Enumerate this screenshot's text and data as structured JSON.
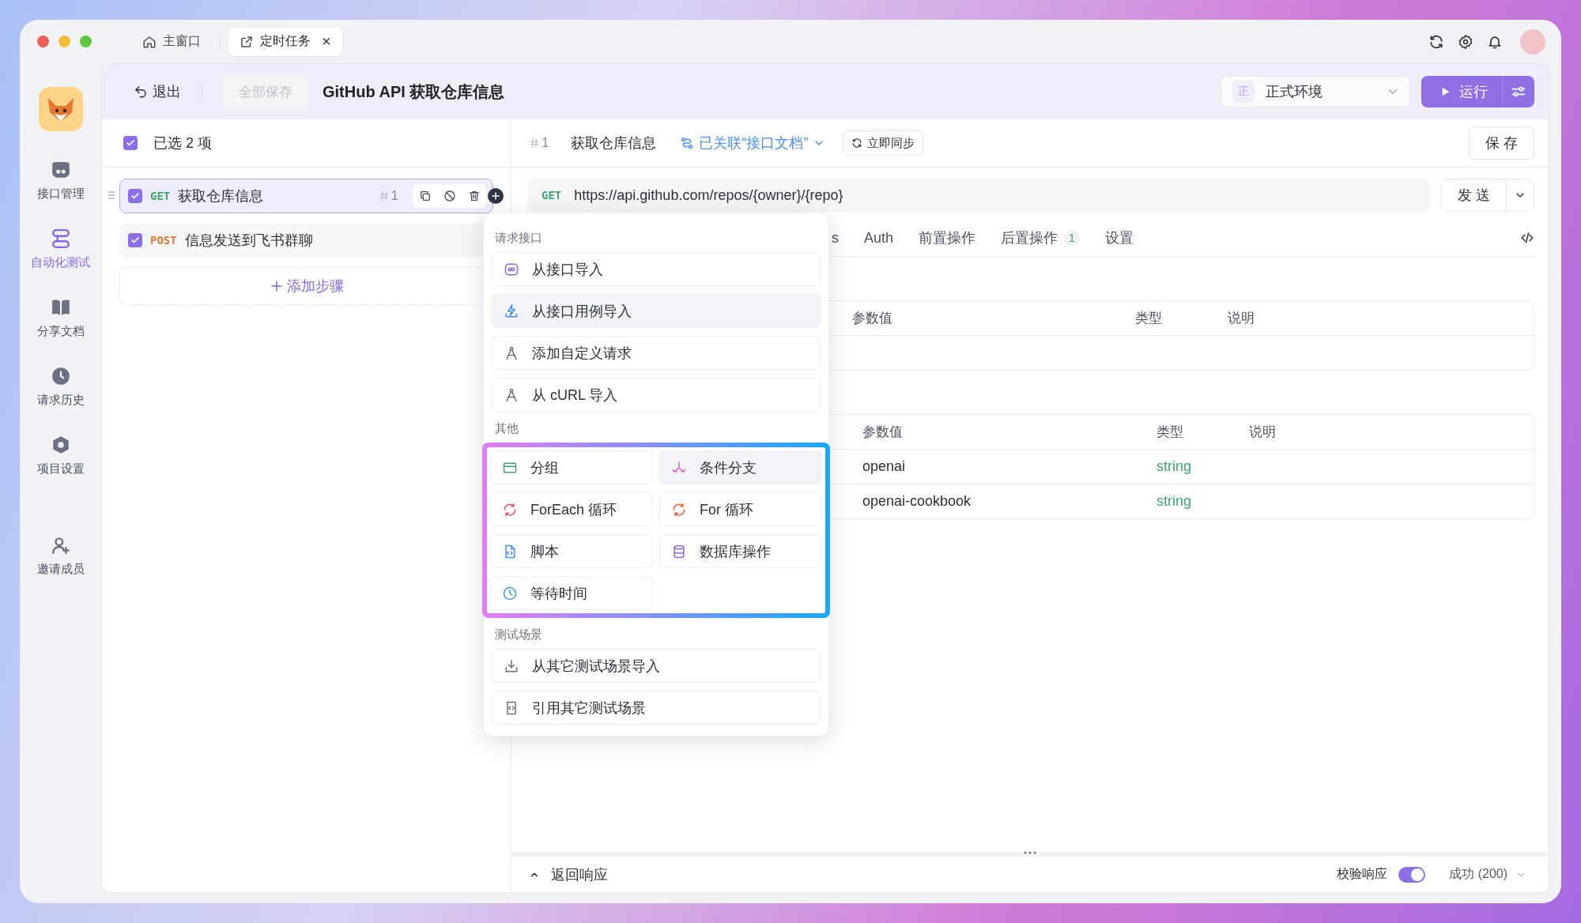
{
  "window_tabs": [
    {
      "label": "主窗口",
      "selected": false
    },
    {
      "label": "定时任务",
      "selected": true,
      "close": "×"
    }
  ],
  "sidebar": {
    "items": [
      {
        "label": "接口管理",
        "selected": false
      },
      {
        "label": "自动化测试",
        "selected": true
      },
      {
        "label": "分享文档",
        "selected": false
      },
      {
        "label": "请求历史",
        "selected": false
      },
      {
        "label": "项目设置",
        "selected": false
      },
      {
        "label": "邀请成员",
        "selected": false
      }
    ]
  },
  "header": {
    "back": "退出",
    "save_all": {
      "label": "全部保存",
      "disabled": true
    },
    "title": "GitHub API 获取仓库信息",
    "environment": {
      "badge": "正",
      "label": "正式环境"
    },
    "run": "运行"
  },
  "steps_panel": {
    "selection": {
      "label": "已选 2 项",
      "checked": true
    },
    "steps": [
      {
        "method": "GET",
        "color": "#3fa56b",
        "name": "获取仓库信息",
        "number": "1",
        "checked": true,
        "selected": true
      },
      {
        "method": "POST",
        "color": "#e0782e",
        "name": "信息发送到飞书群聊",
        "checked": true,
        "selected": false
      }
    ],
    "add_step": "添加步骤"
  },
  "request": {
    "number": "1",
    "name": "获取仓库信息",
    "linked": "已关联“接口文档”",
    "sync": "立即同步",
    "save": "保 存",
    "method": "GET",
    "url": "https://api.github.com/repos/{owner}/{repo}",
    "send": "发 送",
    "tabs": [
      {
        "label": "s"
      },
      {
        "label": "Auth"
      },
      {
        "label": "前置操作"
      },
      {
        "label": "后置操作",
        "badge": "1"
      },
      {
        "label": "设置"
      }
    ],
    "tables": [
      {
        "columns": [
          "参数值",
          "类型",
          "说明"
        ]
      },
      {
        "columns": [
          "参数值",
          "类型",
          "说明"
        ],
        "rows": [
          {
            "value": "openai",
            "type": "string"
          },
          {
            "value": "openai-cookbook",
            "type": "string"
          }
        ]
      }
    ]
  },
  "response": {
    "label": "返回响应",
    "validate": {
      "label": "校验响应",
      "on": true
    },
    "status": "成功 (200)"
  },
  "menu": {
    "sections": [
      {
        "title": "请求接口",
        "kind": "list",
        "highlighted": false,
        "items": [
          {
            "label": "从接口导入",
            "hovered": false
          },
          {
            "label": "从接口用例导入",
            "hovered": true
          },
          {
            "label": "添加自定义请求",
            "hovered": false
          },
          {
            "label": "从 cURL 导入",
            "hovered": false
          }
        ]
      },
      {
        "title": "其他",
        "kind": "grid",
        "highlighted": true,
        "items": [
          {
            "label": "分组",
            "hovered": false
          },
          {
            "label": "条件分支",
            "hovered": true
          },
          {
            "label": "ForEach 循环",
            "hovered": false
          },
          {
            "label": "For 循环",
            "hovered": false
          },
          {
            "label": "脚本",
            "hovered": false
          },
          {
            "label": "数据库操作",
            "hovered": false
          },
          {
            "label": "等待时间",
            "hovered": false
          }
        ]
      },
      {
        "title": "测试场景",
        "kind": "list",
        "highlighted": false,
        "items": [
          {
            "label": "从其它测试场景导入",
            "hovered": false
          },
          {
            "label": "引用其它测试场景",
            "hovered": false
          }
        ]
      }
    ]
  }
}
